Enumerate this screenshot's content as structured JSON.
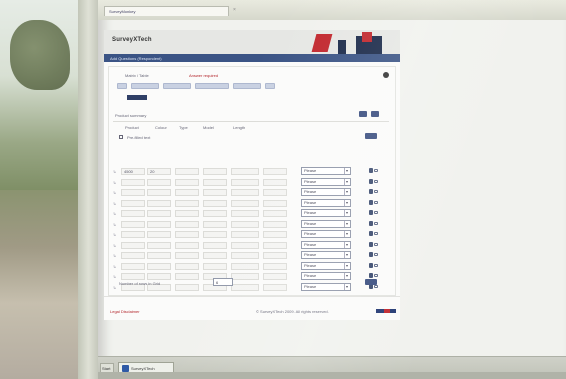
{
  "browser": {
    "tab_label": "SurveyMonkey",
    "tab_close": "×"
  },
  "app": {
    "logo": "SurveyXTech",
    "title_bar": "Add Questions (Respondent)",
    "question_type_label": "Matrix / Table",
    "required_note": "Answer required",
    "products_label": "Product summary",
    "column_headers": [
      "Product",
      "Colour",
      "Type",
      "Model",
      "Length"
    ],
    "checkbox_label": "Pre-filled text",
    "first_row": {
      "value1": "4500",
      "value2": "20"
    },
    "select_value": "Please",
    "rows_count": 12,
    "footer_left": "Legal Disclaimer",
    "footer_right": "© SurveyXTech 2009. All rights reserved.",
    "bottom_prompt": "Number of rows in Grid",
    "bottom_select": "6"
  },
  "taskbar": {
    "start_label": "Start",
    "task_label": "SurveyXTech"
  },
  "colors": {
    "accent": "#3b5485",
    "brand_red": "#c1272d"
  }
}
